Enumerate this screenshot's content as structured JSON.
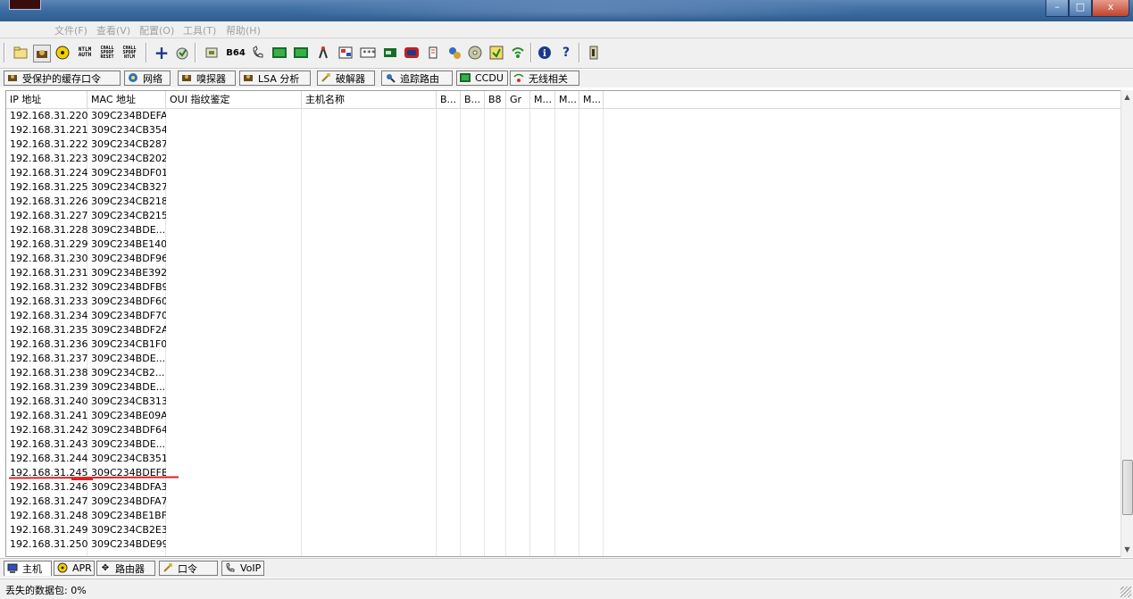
{
  "window": {
    "buttons": [
      "–",
      "□",
      "x"
    ]
  },
  "menu": [
    "文件(F)",
    "查看(V)",
    "配置(O)",
    "工具(T)",
    "帮助(H)"
  ],
  "toolbar": {
    "icons": [
      "open-folder-icon",
      "sniffer-icon",
      "radiation-icon",
      "ntlm-auth-icon",
      "chall-spoof-reset-icon",
      "chall-spoof-ntlm-icon",
      "add-icon",
      "decoder-icon",
      "certificate-icon",
      "base64-icon",
      "voip-icon",
      "wireless-icon",
      "lan-icon",
      "network-icon",
      "rsa-icon",
      "password-icon",
      "card-icon",
      "router-icon",
      "mouse-icon",
      "route-icon",
      "cd-icon",
      "wifi-icon",
      "info-icon",
      "help-icon",
      "exit-icon"
    ],
    "labels": {
      "ntlm_auth": "NTLM AUTH",
      "chall_reset": "CHALL SPOOF RESET",
      "chall_ntlm": "CHALL SPOOF NTLM",
      "base64": "B64"
    }
  },
  "top_tabs": [
    "受保护的缓存口令",
    "网络",
    "嗅探器",
    "LSA 分析",
    "破解器",
    "追踪路由",
    "CCDU",
    "无线相关"
  ],
  "table": {
    "columns": [
      "IP 地址",
      "MAC 地址",
      "OUI 指纹鉴定",
      "主机名称",
      "B...",
      "B...",
      "B8",
      "Gr",
      "M...",
      "M...",
      "M..."
    ],
    "rows": [
      [
        "192.168.31.220",
        "309C234BDEFA"
      ],
      [
        "192.168.31.221",
        "309C234CB354"
      ],
      [
        "192.168.31.222",
        "309C234CB287"
      ],
      [
        "192.168.31.223",
        "309C234CB202"
      ],
      [
        "192.168.31.224",
        "309C234BDF01"
      ],
      [
        "192.168.31.225",
        "309C234CB327"
      ],
      [
        "192.168.31.226",
        "309C234CB218"
      ],
      [
        "192.168.31.227",
        "309C234CB215"
      ],
      [
        "192.168.31.228",
        "309C234BDE..."
      ],
      [
        "192.168.31.229",
        "309C234BE140"
      ],
      [
        "192.168.31.230",
        "309C234BDF96"
      ],
      [
        "192.168.31.231",
        "309C234BE392"
      ],
      [
        "192.168.31.232",
        "309C234BDFB9"
      ],
      [
        "192.168.31.233",
        "309C234BDF60"
      ],
      [
        "192.168.31.234",
        "309C234BDF70"
      ],
      [
        "192.168.31.235",
        "309C234BDF2A"
      ],
      [
        "192.168.31.236",
        "309C234CB1F0"
      ],
      [
        "192.168.31.237",
        "309C234BDE..."
      ],
      [
        "192.168.31.238",
        "309C234CB2..."
      ],
      [
        "192.168.31.239",
        "309C234BDE..."
      ],
      [
        "192.168.31.240",
        "309C234CB313"
      ],
      [
        "192.168.31.241",
        "309C234BE09A"
      ],
      [
        "192.168.31.242",
        "309C234BDF64"
      ],
      [
        "192.168.31.243",
        "309C234BDE..."
      ],
      [
        "192.168.31.244",
        "309C234CB351"
      ],
      [
        "192.168.31.245",
        "309C234BDEFB"
      ],
      [
        "192.168.31.246",
        "309C234BDFA3"
      ],
      [
        "192.168.31.247",
        "309C234BDFA7"
      ],
      [
        "192.168.31.248",
        "309C234BE1BF"
      ],
      [
        "192.168.31.249",
        "309C234CB2E3"
      ],
      [
        "192.168.31.250",
        "309C234BDE99"
      ]
    ]
  },
  "bottom_tabs": [
    "主机",
    "APR",
    "路由器",
    "口令",
    "VoIP"
  ],
  "status": {
    "lost_packets": "丢失的数据包:  0%"
  },
  "colors": {
    "highlight_underline": "#e02020",
    "titlebar": "#3d6da3"
  }
}
